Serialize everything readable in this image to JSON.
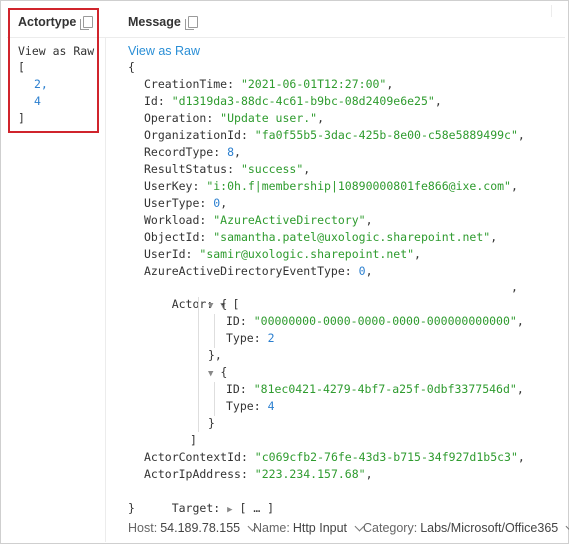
{
  "columns": {
    "actortype": {
      "title": "Actortype",
      "view_raw": "View as Raw",
      "open": "[",
      "values": [
        "2,",
        "4"
      ],
      "close": "]"
    },
    "message": {
      "title": "Message",
      "view_raw": "View as Raw"
    }
  },
  "message": {
    "open": "{",
    "fields": [
      {
        "key": "CreationTime",
        "value": "\"2021-06-01T12:27:00\"",
        "kind": "str"
      },
      {
        "key": "Id",
        "value": "\"d1319da3-88dc-4c61-b9bc-08d2409e6e25\"",
        "kind": "str"
      },
      {
        "key": "Operation",
        "value": "\"Update user.\"",
        "kind": "str"
      },
      {
        "key": "OrganizationId",
        "value": "\"fa0f55b5-3dac-425b-8e00-c58e5889499c\"",
        "kind": "str"
      },
      {
        "key": "RecordType",
        "value": "8",
        "kind": "num"
      },
      {
        "key": "ResultStatus",
        "value": "\"success\"",
        "kind": "str"
      },
      {
        "key": "UserKey",
        "value": "\"i:0h.f|membership|10890000801fe866@ixe.com\"",
        "kind": "str"
      },
      {
        "key": "UserType",
        "value": "0",
        "kind": "num"
      },
      {
        "key": "Workload",
        "value": "\"AzureActiveDirectory\"",
        "kind": "str"
      },
      {
        "key": "ObjectId",
        "value": "\"samantha.patel@uxologic.sharepoint.net\"",
        "kind": "str"
      },
      {
        "key": "UserId",
        "value": "\"samir@uxologic.sharepoint.net\"",
        "kind": "str"
      },
      {
        "key": "AzureActiveDirectoryEventType",
        "value": "0",
        "kind": "num"
      }
    ],
    "actor": {
      "key": "Actor",
      "open": "[",
      "trailing_comma": ",",
      "items": [
        {
          "id_key": "ID",
          "id": "\"00000000-0000-0000-0000-000000000000\"",
          "type_key": "Type",
          "type": "2",
          "close": "},"
        },
        {
          "id_key": "ID",
          "id": "\"81ec0421-4279-4bf7-a25f-0dbf3377546d\"",
          "type_key": "Type",
          "type": "4",
          "close": "}"
        }
      ],
      "close": "]"
    },
    "after": [
      {
        "key": "ActorContextId",
        "value": "\"c069cfb2-76fe-43d3-b715-34f927d1b5c3\"",
        "kind": "str"
      },
      {
        "key": "ActorIpAddress",
        "value": "\"223.234.157.68\"",
        "kind": "str"
      }
    ],
    "target": {
      "key": "Target",
      "collapsed": "[ … ]"
    },
    "close": "}"
  },
  "footer": {
    "host_label": "Host:",
    "host": "54.189.78.155",
    "name_label": "Name:",
    "name": "Http Input",
    "category_label": "Category:",
    "category": "Labs/Microsoft/Office365"
  },
  "colors": {
    "highlight": "#d0242c",
    "link": "#2b8fd6",
    "string": "#2e9b2e",
    "number": "#2b7fcf"
  }
}
